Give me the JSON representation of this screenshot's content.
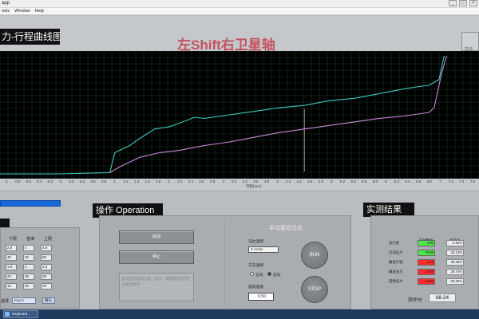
{
  "window": {
    "title": "app",
    "controls": [
      "_",
      "□",
      "×"
    ]
  },
  "menu": [
    "ools",
    "Window",
    "Help"
  ],
  "chart_section": {
    "title": "力-行程曲线图",
    "caption": "左Shift右卫星轴",
    "logo_text": "群瑞",
    "x_axis_title": "行程(mm)"
  },
  "chart_data": {
    "type": "line",
    "title": "力-行程曲线图",
    "subtitle": "左Shift右卫星轴",
    "xlabel": "行程(mm)",
    "ylabel": "",
    "xlim": [
      -1.6,
      8.0
    ],
    "ylim": [
      0,
      1
    ],
    "grid": true,
    "background": "#000000",
    "x_ticks": [
      "-1",
      "-0.8",
      "-0.6",
      "-0.4",
      "-0.2",
      "0",
      "0.2",
      "0.4",
      "0.6",
      "0.8",
      "1",
      "1.2",
      "1.4",
      "1.6",
      "1.8",
      "2",
      "2.2",
      "2.4",
      "2.6",
      "2.8",
      "3",
      "3.2",
      "3.4",
      "3.6",
      "3.8",
      "4",
      "4.2",
      "4.4",
      "4.6",
      "4.8",
      "5",
      "5.2",
      "5.4",
      "5.6",
      "5.8",
      "6",
      "6.2",
      "6.4",
      "6.6",
      "6.8",
      "7",
      "7.2",
      "7.4",
      "7.6"
    ],
    "series": [
      {
        "color": "#3ec9c1",
        "points": [
          [
            -1.6,
            0.0
          ],
          [
            -1.0,
            0.0
          ],
          [
            -0.4,
            0.0
          ],
          [
            0.6,
            0.01
          ],
          [
            0.7,
            0.18
          ],
          [
            1.0,
            0.24
          ],
          [
            1.2,
            0.3
          ],
          [
            1.5,
            0.38
          ],
          [
            1.8,
            0.4
          ],
          [
            2.0,
            0.43
          ],
          [
            2.3,
            0.48
          ],
          [
            2.5,
            0.47
          ],
          [
            3.0,
            0.5
          ],
          [
            3.5,
            0.53
          ],
          [
            4.0,
            0.56
          ],
          [
            4.5,
            0.58
          ],
          [
            5.0,
            0.62
          ],
          [
            5.5,
            0.64
          ],
          [
            6.0,
            0.68
          ],
          [
            6.5,
            0.72
          ],
          [
            6.8,
            0.74
          ],
          [
            7.0,
            0.75
          ],
          [
            7.2,
            0.8
          ],
          [
            7.3,
            1.0
          ]
        ]
      },
      {
        "color": "#c98ad9",
        "points": [
          [
            0.6,
            0.01
          ],
          [
            0.8,
            0.06
          ],
          [
            1.2,
            0.14
          ],
          [
            1.6,
            0.18
          ],
          [
            2.0,
            0.2
          ],
          [
            2.5,
            0.24
          ],
          [
            3.0,
            0.27
          ],
          [
            3.5,
            0.31
          ],
          [
            4.0,
            0.35
          ],
          [
            4.5,
            0.38
          ],
          [
            5.0,
            0.41
          ],
          [
            5.5,
            0.44
          ],
          [
            6.0,
            0.47
          ],
          [
            6.5,
            0.49
          ],
          [
            7.0,
            0.52
          ],
          [
            7.1,
            0.56
          ],
          [
            7.25,
            0.85
          ],
          [
            7.35,
            1.0
          ]
        ]
      }
    ],
    "markers": [
      {
        "type": "vline",
        "x": 4.5,
        "color": "#9a9a9a"
      }
    ]
  },
  "left_panel": {
    "headers": [
      "下限",
      "基准",
      "上限"
    ],
    "rows": [
      [
        "2.8",
        "4",
        "4.8"
      ],
      [
        "40",
        "60",
        "80"
      ],
      [
        "1.8",
        "2",
        "2.5"
      ],
      [
        "20",
        "25",
        "30"
      ],
      [
        "15",
        "20",
        "25"
      ]
    ],
    "select_label": "选择",
    "select_value": "Key-5",
    "select_button": "确认"
  },
  "operation": {
    "title": "操作 Operation",
    "buttons": [
      "启动",
      "停止"
    ],
    "memo_text": "此处显示测试信息，提示、报警等内容均在此框中显示",
    "manual_title": "手动驱动马达",
    "mode_label": "马达选择",
    "mode_value": "X motor",
    "direction_label": "方向选择",
    "direction_options": [
      "正向",
      "反向"
    ],
    "speed_label": "驱动速度",
    "speed_value": "0.50",
    "run_label": "RUN",
    "stop_label": "STOP"
  },
  "results": {
    "title": "实测结果",
    "col_headers": [
      "实测数值",
      "偏差率"
    ],
    "rows": [
      {
        "label": "总行程",
        "value": "3.90",
        "ratio": "-2.62%",
        "status_color": "#4ee64a"
      },
      {
        "label": "启动压力",
        "value": "79.88",
        "ratio": "33.13%",
        "status_color": "#4ee64a"
      },
      {
        "label": "触发行程",
        "value": "2.73",
        "ratio": "36.38%",
        "status_color": "#ff2a2a"
      },
      {
        "label": "触发压力",
        "value": "34.67",
        "ratio": "38.74%",
        "status_color": "#ff2a2a"
      },
      {
        "label": "回弹压力",
        "value": "13.93",
        "ratio": "-30.35%",
        "status_color": "#ff2a2a"
      }
    ],
    "score_label": "测评分",
    "score_value": "68.24"
  },
  "taskbar": {
    "item": "Keyboard..."
  }
}
